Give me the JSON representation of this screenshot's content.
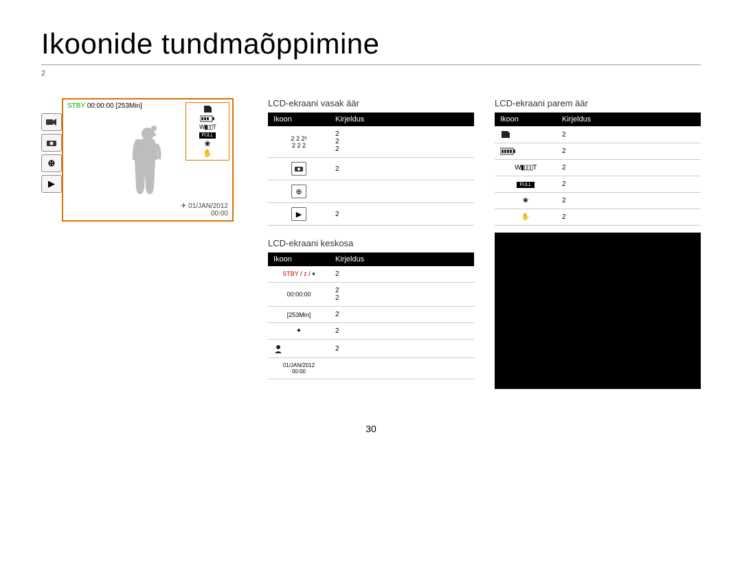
{
  "page": {
    "title": "Ikoonide tundmaõppimine",
    "sub_note": "2",
    "page_number": "30"
  },
  "lcd": {
    "status_green": "STBY",
    "status_time": "00:00:00",
    "status_remain": "[253Min]",
    "date": "01/JAN/2012",
    "clock": "00:00"
  },
  "sections": {
    "left": {
      "title": "LCD-ekraani vasak äär",
      "col_icon": "Ikoon",
      "col_desc": "Kirjeldus",
      "rows": [
        {
          "icon_label": "2 2 2²\n2 2 2",
          "desc": "2\n2\n2"
        },
        {
          "icon_label": "camera-icon",
          "desc": "2"
        },
        {
          "icon_label": "zoom-icon",
          "desc": ""
        },
        {
          "icon_label": "play-icon",
          "desc": "2"
        }
      ]
    },
    "center": {
      "title": "LCD-ekraani keskosa",
      "col_icon": "Ikoon",
      "col_desc": "Kirjeldus",
      "rows": [
        {
          "icon_label": "STBY / z / ⏸",
          "desc": "2",
          "style": "stby"
        },
        {
          "icon_label": "00:00:00",
          "desc": "2\n2"
        },
        {
          "icon_label": "[253Min]",
          "desc": "2"
        },
        {
          "icon_label": "star-icon",
          "desc": "2"
        },
        {
          "icon_label": "face-icon",
          "desc": "2"
        },
        {
          "icon_label": "01/JAN/2012\n00:00",
          "desc": ""
        }
      ]
    },
    "right": {
      "title": "LCD-ekraani parem äär",
      "col_icon": "Ikoon",
      "col_desc": "Kirjeldus",
      "rows": [
        {
          "icon_label": "card-icon",
          "desc": "2"
        },
        {
          "icon_label": "battery-icon",
          "desc": "2"
        },
        {
          "icon_label": "zoom-bar-icon",
          "desc": "2"
        },
        {
          "icon_label": "full-icon",
          "desc": "2"
        },
        {
          "icon_label": "flower-icon",
          "desc": "2"
        },
        {
          "icon_label": "hand-icon",
          "desc": "2"
        }
      ]
    }
  }
}
